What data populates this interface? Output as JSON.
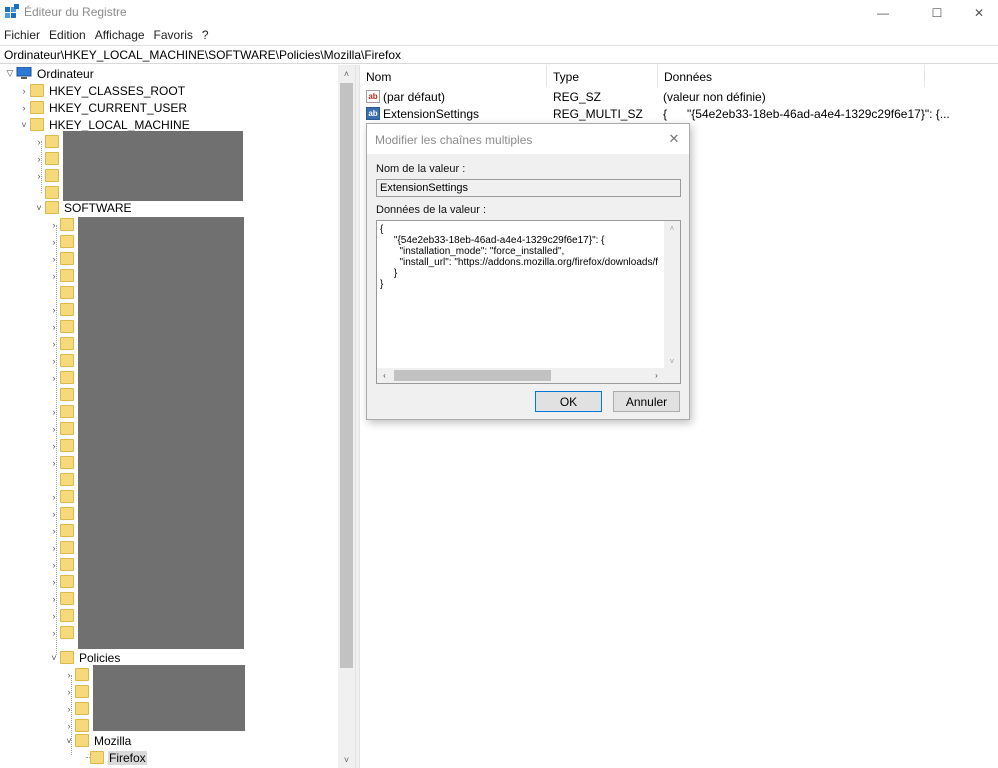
{
  "window": {
    "title": "Éditeur du Registre",
    "minimize_glyph": "—",
    "maximize_glyph": "☐",
    "close_glyph": "✕"
  },
  "menu": [
    "Fichier",
    "Edition",
    "Affichage",
    "Favoris",
    "?"
  ],
  "address": "Ordinateur\\HKEY_LOCAL_MACHINE\\SOFTWARE\\Policies\\Mozilla\\Firefox",
  "tree": {
    "root": "Ordinateur",
    "hives": [
      "HKEY_CLASSES_ROOT",
      "HKEY_CURRENT_USER",
      "HKEY_LOCAL_MACHINE"
    ],
    "software": "SOFTWARE",
    "policies": "Policies",
    "mozilla": "Mozilla",
    "firefox": "Firefox"
  },
  "list": {
    "headers": [
      "Nom",
      "Type",
      "Données"
    ],
    "rows": [
      {
        "name": "(par défaut)",
        "type": "REG_SZ",
        "data": "(valeur non définie)",
        "icon": "ab-string-icon"
      },
      {
        "name": "ExtensionSettings",
        "type": "REG_MULTI_SZ",
        "data": "{      \"{54e2eb33-18eb-46ad-a4e4-1329c29f6e17}\": {...",
        "icon": "ab-multi-string-icon"
      }
    ]
  },
  "dialog": {
    "title": "Modifier les chaînes multiples",
    "name_label": "Nom de la valeur :",
    "name_value": "ExtensionSettings",
    "data_label": "Données de la valeur :",
    "data_value": "{\n     \"{54e2eb33-18eb-46ad-a4e4-1329c29f6e17}\": {\n       \"installation_mode\": \"force_installed\",\n       \"install_url\": \"https://addons.mozilla.org/firefox/downloads/f\n     }\n}",
    "ok": "OK",
    "cancel": "Annuler"
  },
  "colors": {
    "redaction": "#707070",
    "folder": "#f6d97a",
    "selected": "#d9d9d9",
    "accent": "#0078d7"
  }
}
